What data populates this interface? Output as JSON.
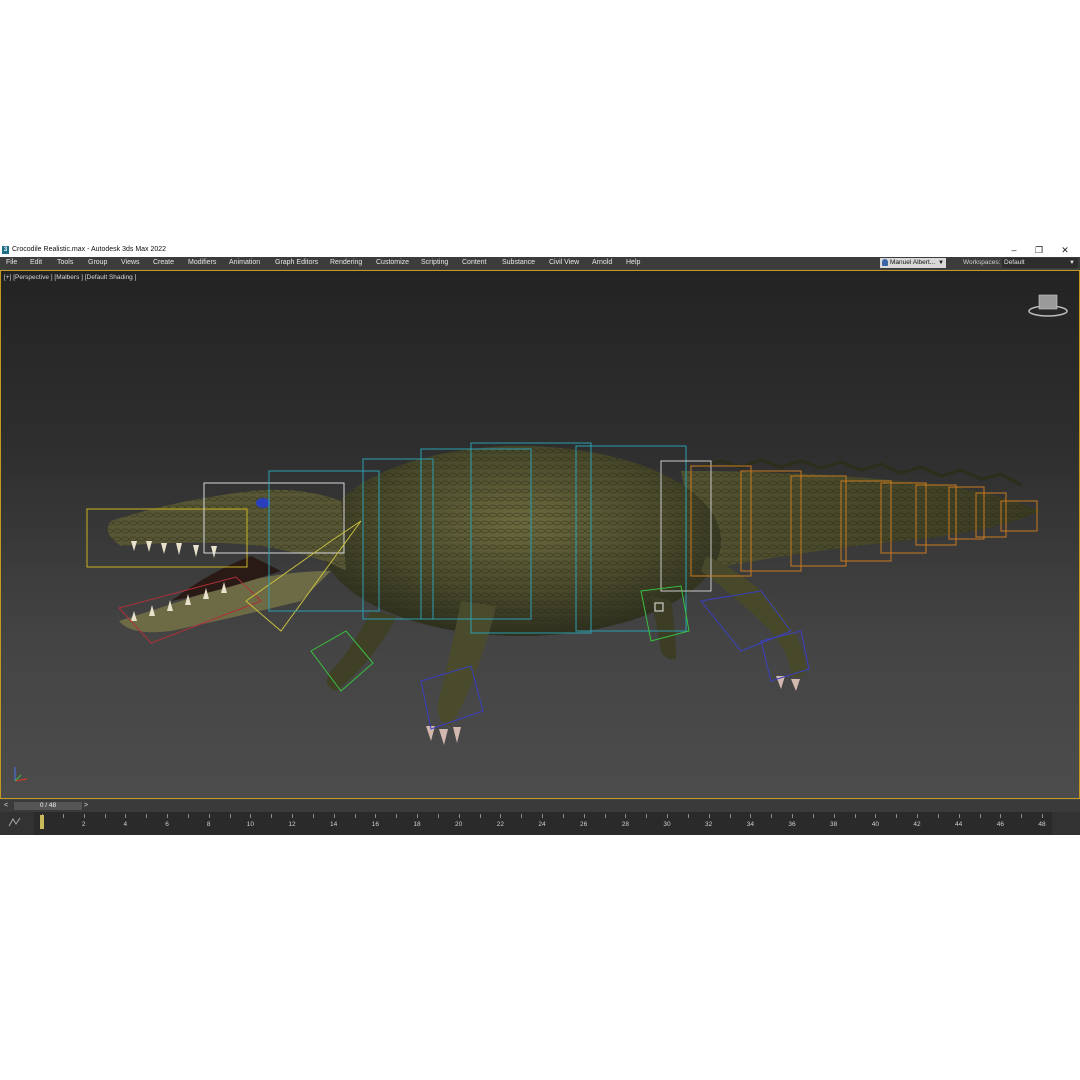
{
  "window": {
    "title": "Crocodile Realistic.max - Autodesk 3ds Max 2022",
    "logo": "3",
    "controls": [
      "minimize-icon",
      "restore-icon",
      "close-icon"
    ]
  },
  "menu": [
    "File",
    "Edit",
    "Tools",
    "Group",
    "Views",
    "Create",
    "Modifiers",
    "Animation",
    "Graph Editors",
    "Rendering",
    "Customize",
    "Scripting",
    "Content",
    "Substance",
    "Civil View",
    "Arnold",
    "Help"
  ],
  "account": {
    "user": "Manuel Albert..."
  },
  "workspaces": {
    "label": "Workspaces:",
    "value": "Default"
  },
  "viewport": {
    "label": "[+] [Perspective ] [Malbers ] [Default Shading ]"
  },
  "timeline": {
    "frame_display": "0 / 48",
    "prev": "<",
    "next": ">",
    "current_frame": 0,
    "total_frames": 48,
    "tick_labels": [
      "2",
      "4",
      "6",
      "8",
      "10",
      "12",
      "14",
      "16",
      "18",
      "20",
      "22",
      "24",
      "26",
      "28",
      "30",
      "32",
      "34",
      "36",
      "38",
      "40",
      "42",
      "44",
      "46",
      "48"
    ]
  },
  "colors": {
    "viewport_border": "#c39a1f",
    "menubar": "#3c3c3c"
  }
}
